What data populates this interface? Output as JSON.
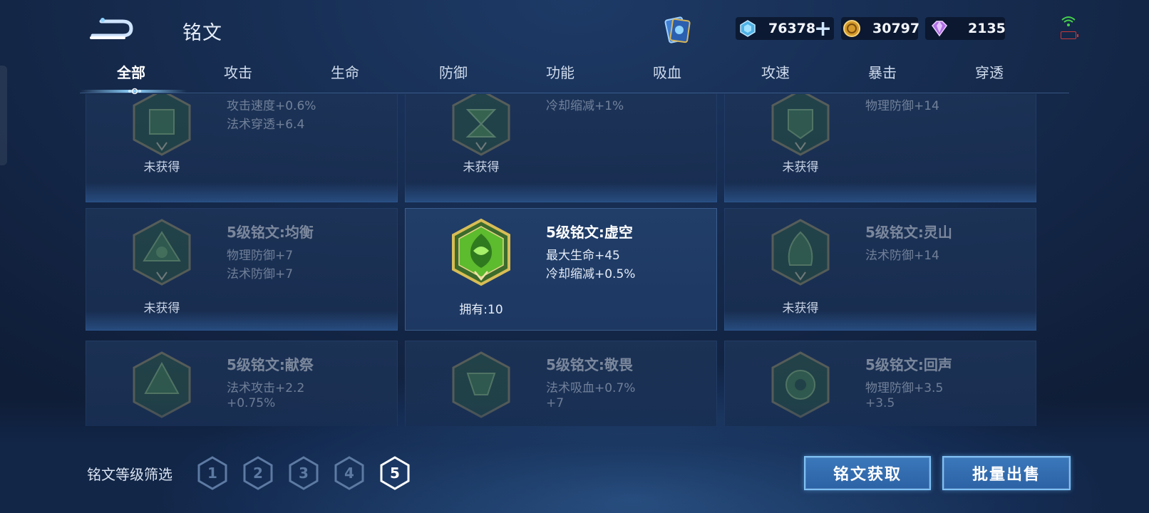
{
  "header": {
    "title": "铭文",
    "currencies": [
      {
        "icon": "diamond-coupon-icon",
        "value": "76378"
      },
      {
        "icon": "gold-coin-icon",
        "value": "30797"
      },
      {
        "icon": "gem-icon",
        "value": "2135"
      }
    ]
  },
  "tabs": [
    "全部",
    "攻击",
    "生命",
    "防御",
    "功能",
    "吸血",
    "攻速",
    "暴击",
    "穿透"
  ],
  "cards": [
    {
      "name": "",
      "stats": [
        "攻击速度+0.6%",
        "法术穿透+6.4"
      ],
      "status": "未获得"
    },
    {
      "name": "",
      "stats": [
        "冷却缩减+1%"
      ],
      "status": "未获得"
    },
    {
      "name": "",
      "stats": [
        "物理防御+14"
      ],
      "status": "未获得"
    },
    {
      "name": "5级铭文:均衡",
      "stats": [
        "物理防御+7",
        "法术防御+7"
      ],
      "status": "未获得"
    },
    {
      "name": "5级铭文:虚空",
      "stats": [
        "最大生命+45",
        "冷却缩减+0.5%"
      ],
      "status": "拥有:10"
    },
    {
      "name": "5级铭文:灵山",
      "stats": [
        "法术防御+14"
      ],
      "status": "未获得"
    },
    {
      "name": "5级铭文:献祭",
      "stats": [
        "法术攻击+2.2",
        "+0.75%"
      ],
      "status": ""
    },
    {
      "name": "5级铭文:敬畏",
      "stats": [
        "法术吸血+0.7%",
        "+7"
      ],
      "status": ""
    },
    {
      "name": "5级铭文:回声",
      "stats": [
        "物理防御+3.5",
        "+3.5"
      ],
      "status": ""
    }
  ],
  "filter": {
    "label": "铭文等级筛选",
    "levels": [
      "1",
      "2",
      "3",
      "4",
      "5"
    ],
    "selected": "5"
  },
  "buttons": {
    "acquire": "铭文获取",
    "bulk_sell": "批量出售"
  },
  "colors": {
    "accent": "#8fd4ff",
    "button": "#2f6aae",
    "badge_green": "#55c238",
    "badge_gold": "#c9a944"
  }
}
